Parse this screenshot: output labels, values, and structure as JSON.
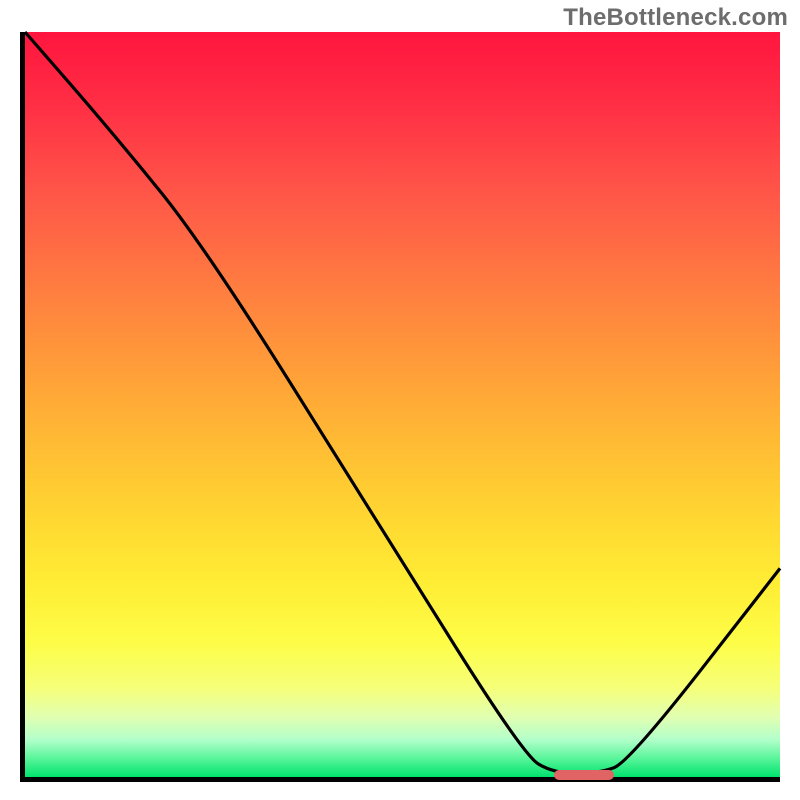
{
  "watermark": "TheBottleneck.com",
  "chart_data": {
    "type": "line",
    "title": "",
    "xlabel": "",
    "ylabel": "",
    "xlim": [
      0,
      100
    ],
    "ylim": [
      0,
      100
    ],
    "series": [
      {
        "name": "curve",
        "x": [
          0,
          12,
          24,
          48,
          66,
          70,
          76,
          80,
          100
        ],
        "y": [
          100,
          86,
          71,
          32,
          3,
          0.5,
          0.5,
          2,
          28
        ]
      }
    ],
    "marker": {
      "x_start": 70,
      "x_end": 78,
      "y": 0.3
    },
    "background_gradient": {
      "stops": [
        {
          "pos": 0,
          "color": "#ff153e"
        },
        {
          "pos": 0.5,
          "color": "#ffa637"
        },
        {
          "pos": 0.82,
          "color": "#fdfd47"
        },
        {
          "pos": 1.0,
          "color": "#00e36d"
        }
      ],
      "direction": "top-to-bottom"
    }
  }
}
